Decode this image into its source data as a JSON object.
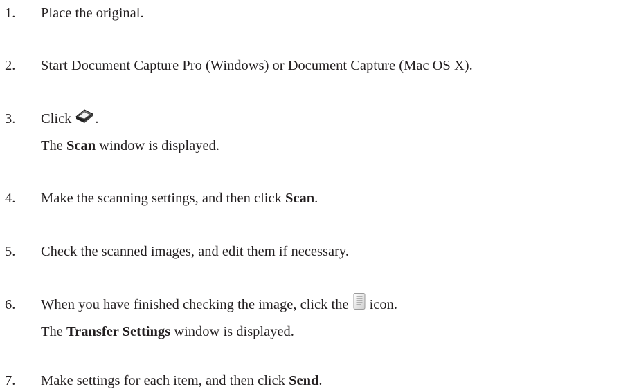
{
  "steps": [
    {
      "num": "1.",
      "text": "Place the original."
    },
    {
      "num": "2.",
      "text": "Start Document Capture Pro (Windows) or Document Capture (Mac OS X)."
    },
    {
      "num": "3.",
      "text_before": "Click",
      "text_after": ".",
      "icon": "scanner-icon",
      "result": {
        "pre": "The ",
        "bold": "Scan",
        "post": " window is displayed."
      }
    },
    {
      "num": "4.",
      "text_before": "Make the scanning settings, and then click ",
      "bold": "Scan",
      "text_after": "."
    },
    {
      "num": "5.",
      "text": "Check the scanned images, and edit them if necessary."
    },
    {
      "num": "6.",
      "text_before": "When you have finished checking the image, click the",
      "text_after": "icon.",
      "icon": "document-icon",
      "result": {
        "pre": "The ",
        "bold": "Transfer Settings",
        "post": " window is displayed."
      }
    },
    {
      "num": "7.",
      "text_before": "Make settings for each item, and then click ",
      "bold": "Send",
      "text_after": "."
    }
  ]
}
